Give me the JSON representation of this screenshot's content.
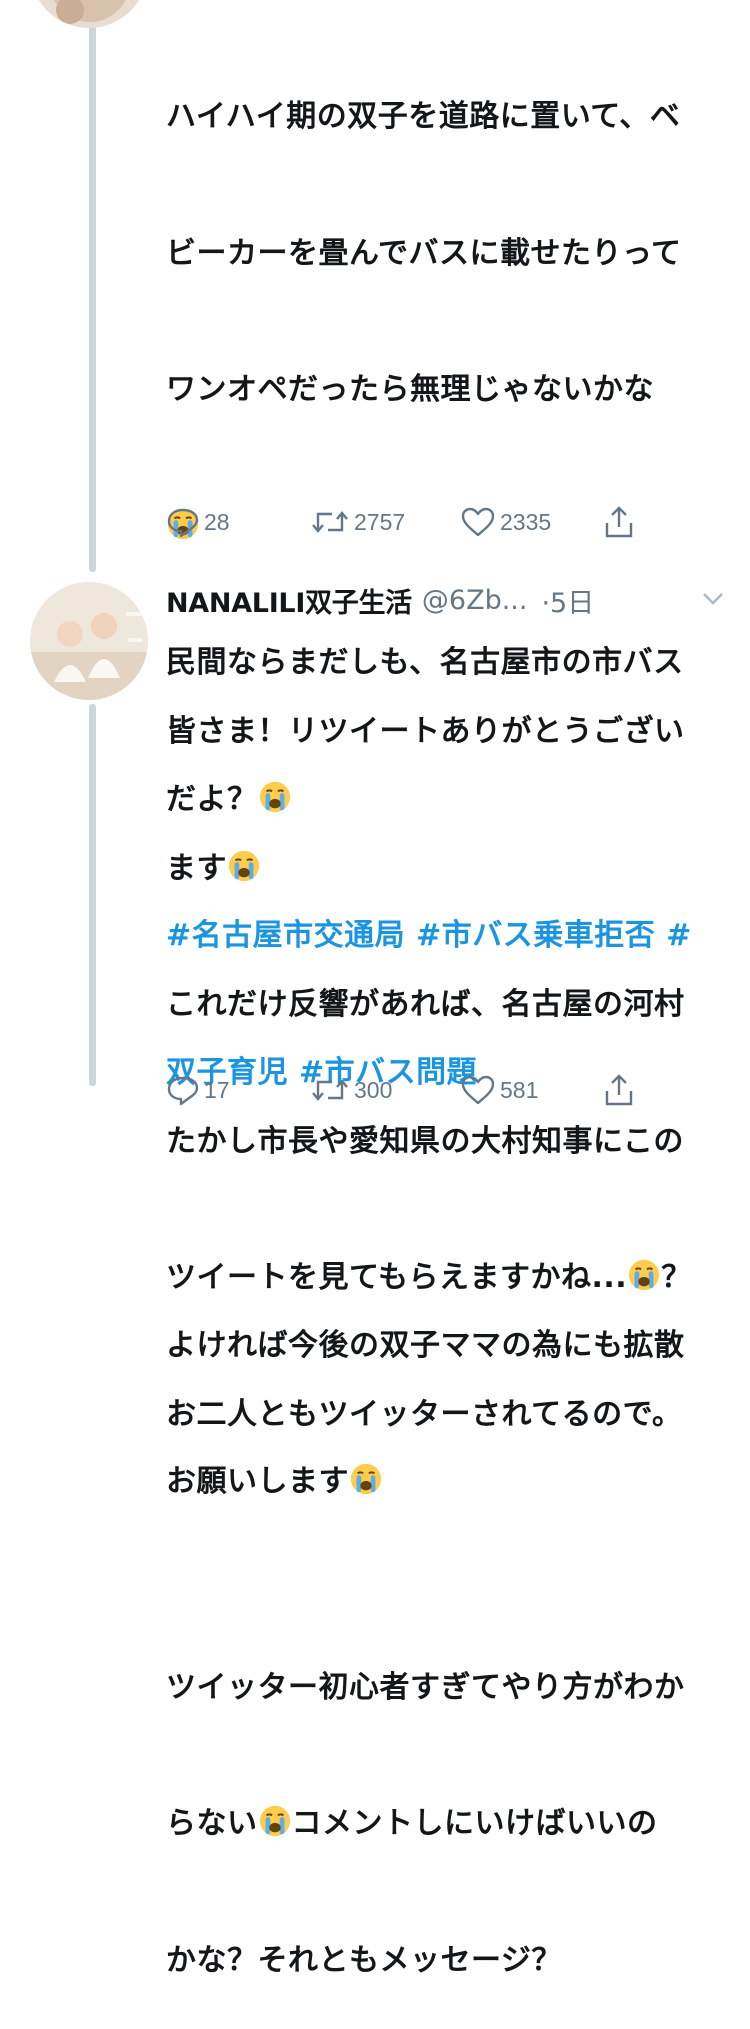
{
  "tweet1": {
    "lines": [
      "ハイハイ期の双子を道路に置いて、ベ",
      "ビーカーを畳んでバスに載せたりって",
      "ワンオペだったら無理じゃないかな",
      "",
      "民間ならまだしも、名古屋市の市バス",
      "だよ？"
    ],
    "hashtags_line1": "#名古屋市交通局 #市バス乗車拒否 #",
    "hashtags_line2": "双子育児 #市バス問題",
    "para2_line1": "よければ今後の双子ママの為にも拡散",
    "para2_line2": "お願いします",
    "actions": {
      "replies": "28",
      "retweets": "2757",
      "likes": "2335"
    }
  },
  "tweet2": {
    "display_name": "NANALILI双子生活",
    "handle": "@6Zb...",
    "time": "·5日",
    "lines": [
      "皆さま！リツイートありがとうござい",
      "ます",
      "これだけ反響があれば、名古屋の河村",
      "たかし市長や愛知県の大村知事にこの",
      "ツイートを見てもらえますかね...",
      "お二人ともツイッターされてるので。",
      "",
      "ツイッター初心者すぎてやり方がわか",
      "らない",
      "かな？それともメッセージ？"
    ],
    "line5_suffix": "？",
    "line9_suffix": "コメントしにいけばいいの",
    "actions": {
      "replies": "17",
      "retweets": "300",
      "likes": "581"
    }
  },
  "icons": {
    "emoji": "loudly-crying-face-icon",
    "reply": "reply-icon",
    "retweet": "retweet-icon",
    "like": "heart-icon",
    "share": "share-icon",
    "caret": "chevron-down-icon"
  },
  "colors": {
    "hashtag": "#1b95e0",
    "meta": "#657786",
    "text": "#14171a",
    "thread_line": "#ccd6dd"
  }
}
